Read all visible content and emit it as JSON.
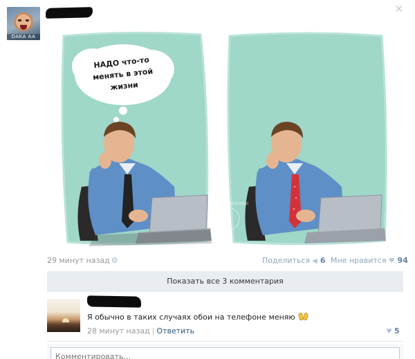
{
  "post": {
    "time": "29 минут назад",
    "share_label": "Поделиться",
    "share_count": "6",
    "like_label": "Мне нравится",
    "like_count": "94",
    "avatar_caption": "DAKA AA",
    "image": {
      "bubble_text": [
        "НАДО что-то",
        "менять в этой",
        "жизни"
      ],
      "watermark": "vk.com/postirnewsl"
    }
  },
  "comments": {
    "show_all_label": "Показать все 3 комментария",
    "items": [
      {
        "text": "Я обычно в таких случаях обои на телефоне меняю",
        "emoji": "raised-hands",
        "time": "28 минут назад",
        "separator": "|",
        "reply_label": "Ответить",
        "like_count": "5"
      }
    ]
  },
  "composer": {
    "placeholder": "Комментировать..."
  },
  "icons": {
    "close": "close-icon",
    "settings": "gear-icon",
    "share": "megaphone-icon",
    "like": "heart-icon"
  },
  "colors": {
    "link": "#2b587a",
    "accent": "#6582a5",
    "muted": "#999999",
    "panel_bg": "#e9edf1",
    "image_bg": "#9fd7c8"
  }
}
